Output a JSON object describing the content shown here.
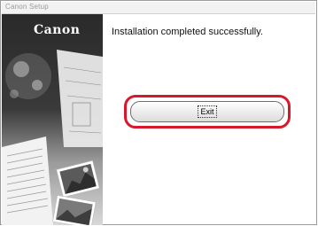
{
  "window": {
    "title": "Canon Setup"
  },
  "branding": {
    "logo": "Canon"
  },
  "main": {
    "heading": "Installation completed successfully.",
    "exit_label": "Exit"
  },
  "colors": {
    "highlight": "#d7182a",
    "panel_dark": "#2a2a2a"
  }
}
